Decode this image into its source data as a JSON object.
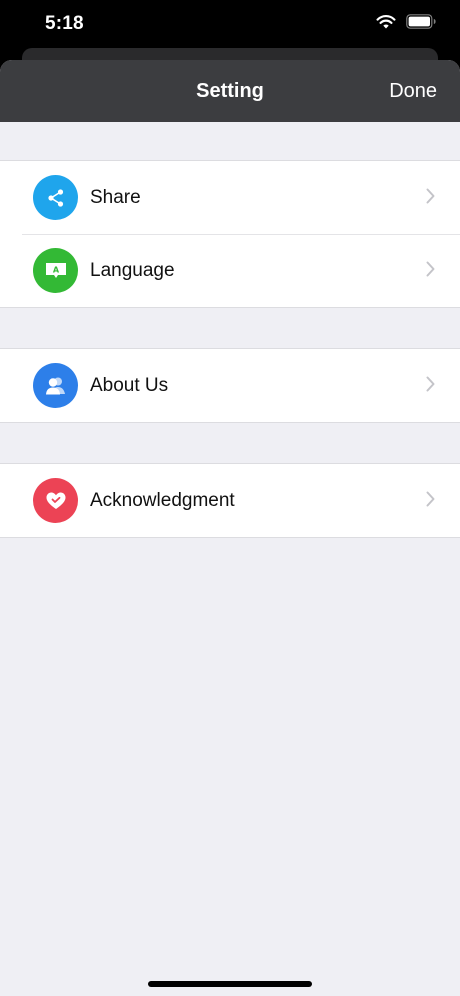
{
  "status_bar": {
    "time": "5:18"
  },
  "nav": {
    "title": "Setting",
    "done_label": "Done"
  },
  "groups": [
    {
      "items": [
        {
          "label": "Share",
          "icon": "share-icon",
          "color": "#1fa5ec"
        },
        {
          "label": "Language",
          "icon": "language-icon",
          "color": "#33b935"
        }
      ]
    },
    {
      "items": [
        {
          "label": "About Us",
          "icon": "about-us-icon",
          "color": "#2d7fe9"
        }
      ]
    },
    {
      "items": [
        {
          "label": "Acknowledgment",
          "icon": "heart-icon",
          "color": "#ec4355"
        }
      ]
    }
  ],
  "colors": {
    "nav_background": "#3c3d40",
    "page_background": "#efeff4",
    "chevron": "#c4c4c9"
  }
}
